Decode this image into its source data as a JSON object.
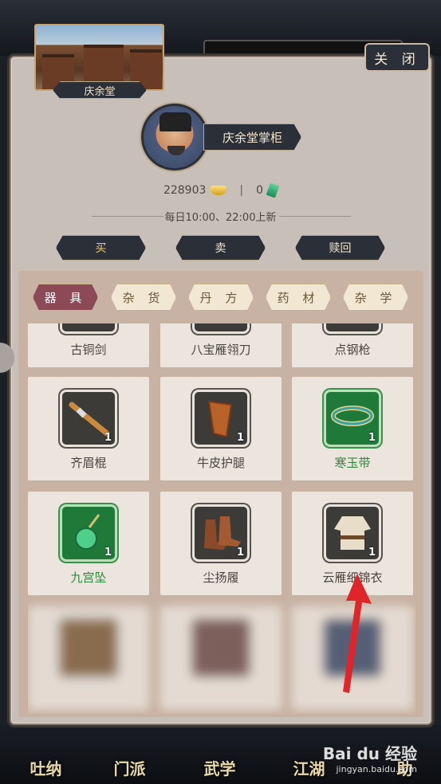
{
  "shop": {
    "name": "庆余堂",
    "close_label": "关 闭"
  },
  "npc": {
    "name": "庆余堂掌柜"
  },
  "currency": {
    "gold": "228903",
    "jade": "0"
  },
  "refresh_text": "每日10:00、22:00上新",
  "actions": [
    "买",
    "卖",
    "赎回"
  ],
  "categories": [
    "器 具",
    "杂 货",
    "丹 方",
    "药 材",
    "杂 学"
  ],
  "items": [
    {
      "name": "古铜剑",
      "quality": "normal"
    },
    {
      "name": "八宝雁翎刀",
      "quality": "normal"
    },
    {
      "name": "点钢枪",
      "quality": "normal"
    },
    {
      "name": "齐眉棍",
      "quality": "normal",
      "qty": "1"
    },
    {
      "name": "牛皮护腿",
      "quality": "normal",
      "qty": "1"
    },
    {
      "name": "寒玉带",
      "quality": "green",
      "qty": "1"
    },
    {
      "name": "九宫坠",
      "quality": "green",
      "qty": "1"
    },
    {
      "name": "尘扬履",
      "quality": "normal",
      "qty": "1"
    },
    {
      "name": "云雁细锦衣",
      "quality": "normal",
      "qty": "1"
    }
  ],
  "bottom_nav": [
    "吐纳",
    "门派",
    "武学",
    "江湖",
    "助"
  ],
  "watermark": {
    "brand": "Bai du 经验",
    "url": "jingyan.baidu.com"
  },
  "colors": {
    "panel": "#c9bfb9",
    "dark_button": "#2b2f37",
    "active_tab": "#8b4a55",
    "green_quality": "#2e8a3e"
  }
}
